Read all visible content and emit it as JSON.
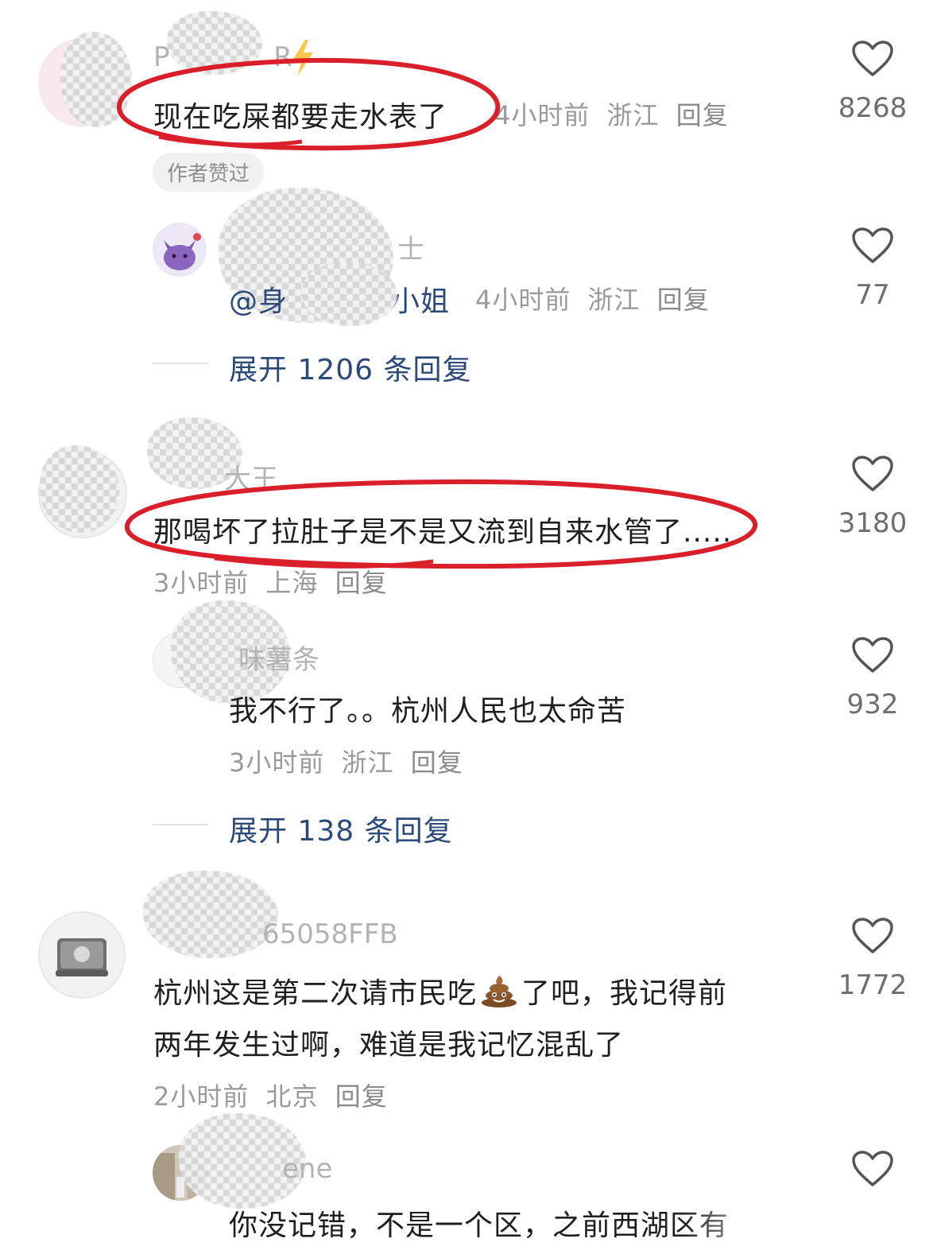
{
  "comments": [
    {
      "username": "P R",
      "text": "现在吃屎都要走水表了",
      "time": "4小时前",
      "location": "浙江",
      "reply_label": "回复",
      "badge": "作者赞过",
      "likes": "8268"
    },
    {
      "username": "士",
      "mention": "@身",
      "mention_tail": "小姐",
      "time": "4小时前",
      "location": "浙江",
      "reply_label": "回复",
      "likes": "77",
      "expand": "展开 1206 条回复"
    },
    {
      "username": "大王",
      "text": "那喝坏了拉肚子是不是又流到自来水管了.....",
      "time": "3小时前",
      "location": "上海",
      "reply_label": "回复",
      "likes": "3180"
    },
    {
      "username": "味薯条",
      "text": "我不行了。。杭州人民也太命苦",
      "time": "3小时前",
      "location": "浙江",
      "reply_label": "回复",
      "likes": "932",
      "expand": "展开 138 条回复"
    },
    {
      "username": "65058FFB",
      "text_line1_a": "杭州这是第二次请市民吃",
      "text_line1_b": "了吧，我记得前",
      "text_line2": "两年发生过啊，难道是我记忆混乱了",
      "time": "2小时前",
      "location": "北京",
      "reply_label": "回复",
      "likes": "1772"
    },
    {
      "username": "ene",
      "text": "你没记错，不是一个区，之前西湖区有",
      "likes": ""
    }
  ],
  "colors": {
    "annotation_red": "#d9202a",
    "link_blue": "#2b4a7a",
    "meta_gray": "#9a9a9a"
  },
  "icons": {
    "like": "heart-outline-icon",
    "emoji": "poop-emoji-icon",
    "lightning": "lightning-icon"
  }
}
